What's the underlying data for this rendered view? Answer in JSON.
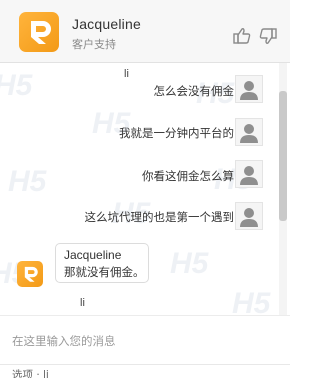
{
  "header": {
    "agent_name": "Jacqueline",
    "agent_role": "客户支持",
    "thumb_up_icon": "thumbs-up-icon",
    "thumb_down_icon": "thumbs-down-icon"
  },
  "chat": {
    "user_label": "li",
    "agent_label": "li",
    "messages": [
      {
        "sender": "user",
        "text": "怎么会没有佣金"
      },
      {
        "sender": "user",
        "text": "我就是一分钟内平台的"
      },
      {
        "sender": "user",
        "text": "你看这佣金怎么算"
      },
      {
        "sender": "user",
        "text": "这么坑代理的也是第一个遇到"
      }
    ],
    "agent_message": {
      "name": "Jacqueline",
      "text": "那就没有佣金。"
    },
    "watermark": "H5"
  },
  "input": {
    "placeholder": "在这里输入您的消息",
    "value": ""
  },
  "footer": {
    "text": "选项 ·  li"
  },
  "colors": {
    "brand": "#f39a17",
    "header_bg": "#f7f7f7",
    "watermark": "#eef1f5"
  }
}
